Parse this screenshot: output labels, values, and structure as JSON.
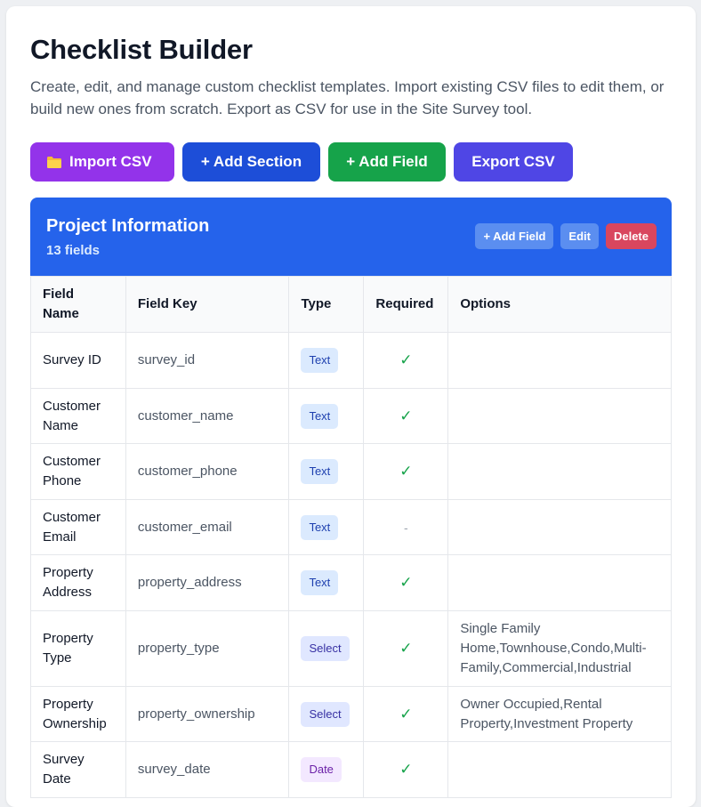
{
  "page": {
    "title": "Checklist Builder",
    "description": "Create, edit, and manage custom checklist templates. Import existing CSV files to edit them, or build new ones from scratch. Export as CSV for use in the Site Survey tool."
  },
  "toolbar": {
    "import_label": "Import CSV",
    "import_icon": "folder-icon",
    "add_section_label": "+ Add Section",
    "add_field_label": "+ Add Field",
    "export_label": "Export CSV"
  },
  "colors": {
    "import": "#9333ea",
    "add_section": "#1d4ed8",
    "add_field": "#16a34a",
    "export": "#4f46e5",
    "section_header": "#2563eb",
    "delete": "#d9465e"
  },
  "section": {
    "title": "Project Information",
    "count": "13 fields",
    "add_field_label": "+ Add Field",
    "edit_label": "Edit",
    "delete_label": "Delete"
  },
  "table": {
    "headers": [
      "Field Name",
      "Field Key",
      "Type",
      "Required",
      "Options"
    ],
    "rows": [
      {
        "name": "Survey ID",
        "key": "survey_id",
        "type": "Text",
        "required": "✓",
        "options": ""
      },
      {
        "name": "Customer Name",
        "key": "customer_name",
        "type": "Text",
        "required": "✓",
        "options": ""
      },
      {
        "name": "Customer Phone",
        "key": "customer_phone",
        "type": "Text",
        "required": "✓",
        "options": ""
      },
      {
        "name": "Customer Email",
        "key": "customer_email",
        "type": "Text",
        "required": "-",
        "options": ""
      },
      {
        "name": "Property Address",
        "key": "property_address",
        "type": "Text",
        "required": "✓",
        "options": ""
      },
      {
        "name": "Property Type",
        "key": "property_type",
        "type": "Select",
        "required": "✓",
        "options": "Single Family Home,Townhouse,Condo,Multi-Family,Commercial,Industrial"
      },
      {
        "name": "Property Ownership",
        "key": "property_ownership",
        "type": "Select",
        "required": "✓",
        "options": "Owner Occupied,Rental Property,Investment Property"
      },
      {
        "name": "Survey Date",
        "key": "survey_date",
        "type": "Date",
        "required": "✓",
        "options": ""
      }
    ]
  }
}
